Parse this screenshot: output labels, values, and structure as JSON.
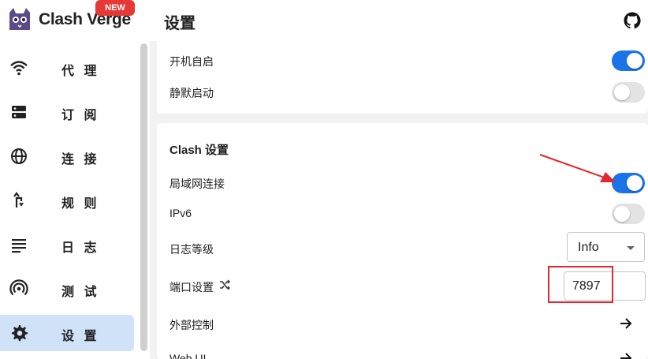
{
  "sidebar": {
    "app_name": "Clash Verge",
    "badge": "NEW",
    "items": [
      {
        "label": "代 理",
        "icon": "wifi-icon"
      },
      {
        "label": "订 阅",
        "icon": "storage-icon"
      },
      {
        "label": "连 接",
        "icon": "globe-icon"
      },
      {
        "label": "规 则",
        "icon": "fork-icon"
      },
      {
        "label": "日 志",
        "icon": "notes-icon"
      },
      {
        "label": "测 试",
        "icon": "broadcast-icon"
      },
      {
        "label": "设 置",
        "icon": "gear-icon",
        "active": true
      }
    ]
  },
  "header": {
    "title": "设置",
    "github_icon": "github-icon"
  },
  "system_section": {
    "auto_launch": {
      "label": "开机自启",
      "enabled": true
    },
    "silent_start": {
      "label": "静默启动",
      "enabled": false
    }
  },
  "clash_section": {
    "title": "Clash 设置",
    "allow_lan": {
      "label": "局域网连接",
      "enabled": true
    },
    "ipv6": {
      "label": "IPv6",
      "enabled": false
    },
    "log_level": {
      "label": "日志等级",
      "value": "Info"
    },
    "port": {
      "label": "端口设置",
      "value": "7897"
    },
    "external_control": {
      "label": "外部控制"
    },
    "web_ui": {
      "label": "Web UI"
    }
  },
  "colors": {
    "accent": "#1a73e8",
    "active_nav": "#cfe2f7",
    "badge": "#e53935",
    "annotation": "#e0282e"
  }
}
